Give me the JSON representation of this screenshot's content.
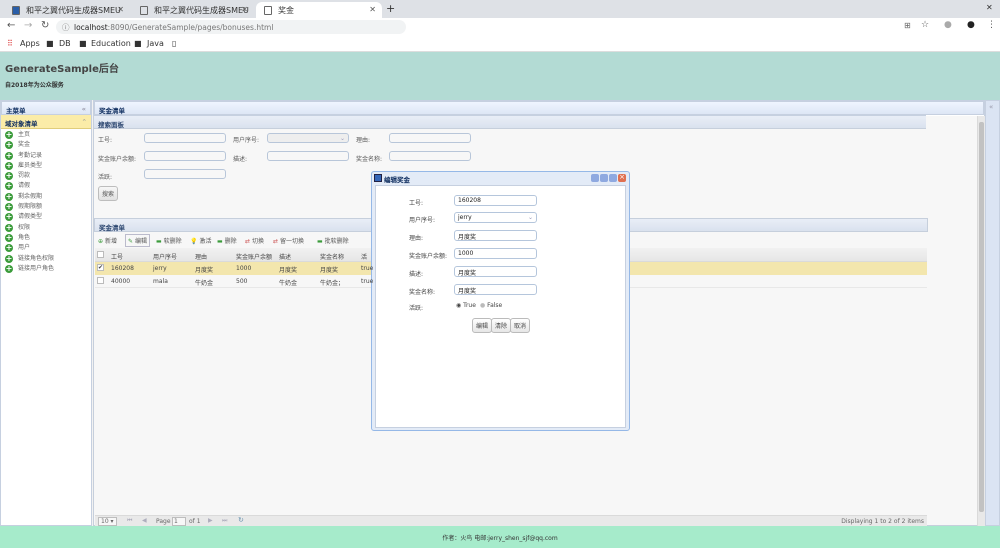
{
  "browser": {
    "tabs": [
      {
        "title": "和平之翼代码生成器SMEU"
      },
      {
        "title": "和平之翼代码生成器SMEU"
      },
      {
        "title": "奖金"
      }
    ],
    "url_host": "localhost",
    "url_path": ":8090/GenerateSample/pages/bonuses.html",
    "bookmarks": [
      "Apps",
      "DB",
      "Education",
      "Java"
    ]
  },
  "header": {
    "title": "GenerateSample后台",
    "subtitle": "自2018年为公众服务"
  },
  "sidebar": {
    "title": "主菜单",
    "section": "域对象清单",
    "items": [
      "主页",
      "奖金",
      "考勤记录",
      "雇员类型",
      "罚款",
      "请假",
      "剩余假期",
      "假期限额",
      "请假类型",
      "权限",
      "角色",
      "用户",
      "链接角色权限",
      "链接用户角色"
    ]
  },
  "main": {
    "title": "奖金清单",
    "search": {
      "title": "搜索面板",
      "fields": {
        "empno": "工号:",
        "userid": "用户序号:",
        "reason": "理由:",
        "balance": "奖金账户余额:",
        "desc": "描述:",
        "name": "奖金名称:",
        "active": "活跃:"
      },
      "button": "搜索"
    },
    "grid": {
      "title": "奖金清单",
      "toolbar": [
        "新增",
        "编辑",
        "软删除",
        "激活",
        "删除",
        "切换",
        "留一切换",
        "批软删除"
      ],
      "columns": [
        "工号",
        "用户序号",
        "理由",
        "奖金账户余额",
        "描述",
        "奖金名称",
        "活"
      ],
      "rows": [
        [
          "160208",
          "jerry",
          "月度奖",
          "1000",
          "月度奖",
          "月度奖",
          "true"
        ],
        [
          "40000",
          "mala",
          "牛奶金",
          "500",
          "牛奶金",
          "牛奶金；",
          "true"
        ]
      ],
      "pager": {
        "size": "10",
        "page_label": "Page",
        "page": "1",
        "of": "of 1",
        "display": "Displaying 1 to 2 of 2 items"
      }
    }
  },
  "dialog": {
    "title": "编辑奖金",
    "labels": [
      "工号:",
      "用户序号:",
      "理由:",
      "奖金账户余额:",
      "描述:",
      "奖金名称:",
      "活跃:"
    ],
    "values": [
      "160208",
      "jerry",
      "月度奖",
      "1000",
      "月度奖",
      "月度奖"
    ],
    "radio_true": "True",
    "radio_false": "False",
    "buttons": [
      "编辑",
      "清除",
      "取消"
    ]
  },
  "footer": "作者：火鸟 电邮:jerry_shen_sjf@qq.com"
}
